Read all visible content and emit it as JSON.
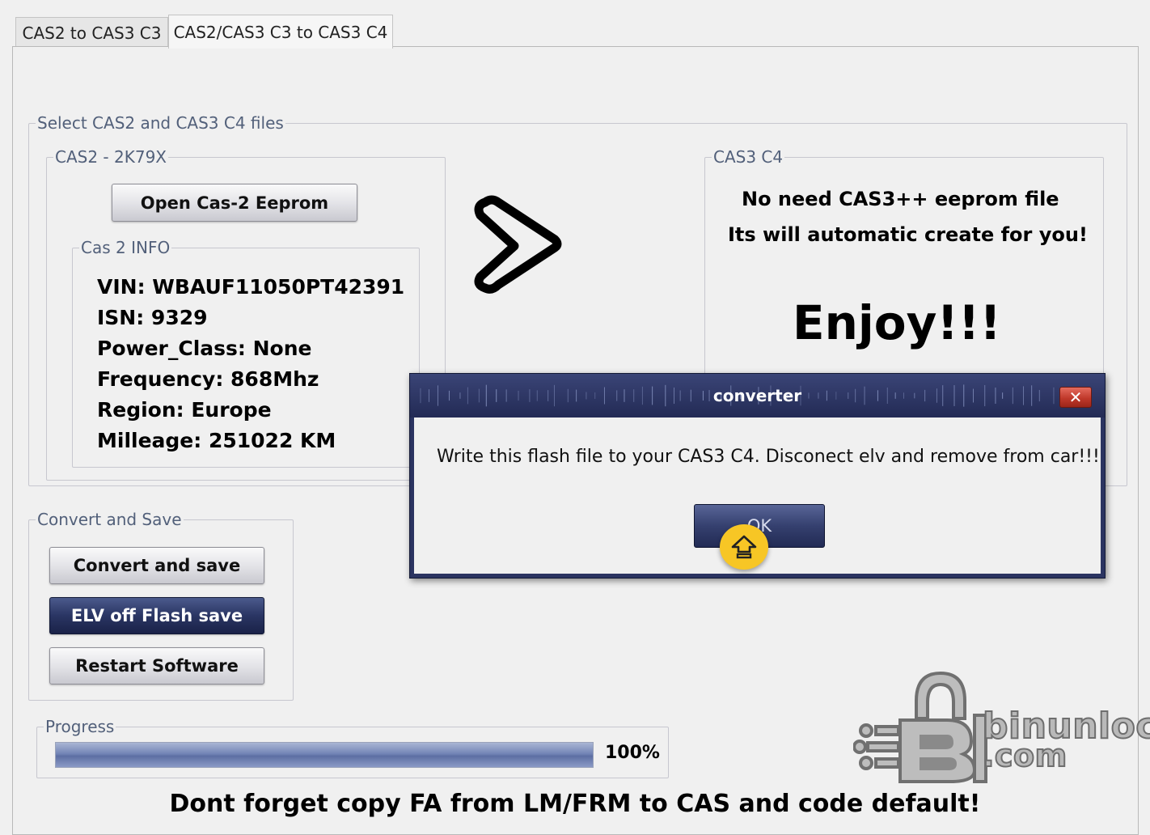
{
  "tabs": [
    {
      "label": "CAS2 to CAS3 C3",
      "active": false
    },
    {
      "label": "CAS2/CAS3 C3 to CAS3 C4",
      "active": true
    }
  ],
  "select_group": {
    "legend": "Select CAS2 and CAS3 C4 files",
    "cas2_group": {
      "legend": "CAS2 - 2K79X",
      "open_button": "Open Cas-2 Eeprom",
      "info_group": {
        "legend": "Cas 2 INFO",
        "lines": [
          "VIN: WBAUF11050PT42391",
          "ISN: 9329",
          "Power_Class:  None",
          "Frequency:  868Mhz",
          "Region:  Europe",
          "Milleage: 251022 KM"
        ]
      }
    },
    "cas3_group": {
      "legend": "CAS3 C4",
      "line1": "No need CAS3++ eeprom file",
      "line2": "Its will automatic create for you!",
      "enjoy": "Enjoy!!!"
    }
  },
  "convert_group": {
    "legend": "Convert and Save",
    "convert_button": "Convert and save",
    "elv_button": "ELV off Flash save",
    "restart_button": "Restart Software"
  },
  "progress": {
    "legend": "Progress",
    "value": 1.0,
    "label": "100%"
  },
  "footer_text": "Dont forget copy FA from LM/FRM to CAS and code default!",
  "dialog": {
    "title": "converter",
    "close_label": "✕",
    "message": "Write this flash file to your CAS3 C4. Disconect elv and remove from car!!!",
    "ok_label": "OK"
  },
  "watermark": {
    "line1": "binunlock",
    "line2": ".com"
  },
  "colors": {
    "accent_dark": "#2a3563",
    "legend_text": "#52607a",
    "close_red": "#c0392b",
    "cursor_yellow": "#f7c625"
  },
  "icons": [
    "chevron-right-icon",
    "home-up-icon",
    "lock-logo-icon"
  ]
}
